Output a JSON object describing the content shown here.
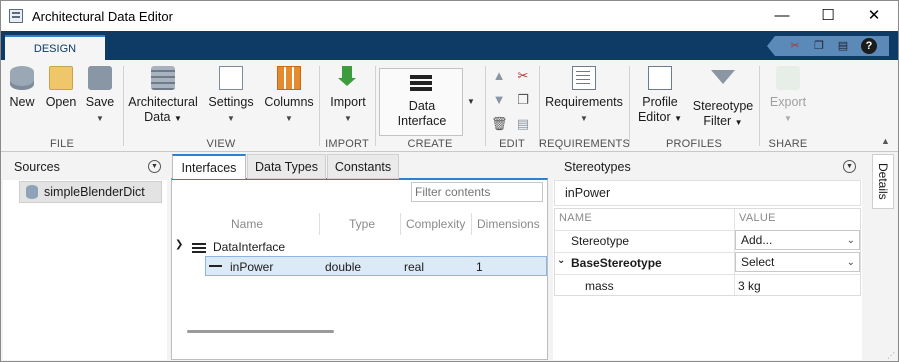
{
  "window": {
    "title": "Architectural Data Editor",
    "minimize": "—",
    "maximize": "☐",
    "close": "✕"
  },
  "ribbon_tab": "DESIGN",
  "quick_access": {
    "help": "?"
  },
  "toolstrip": {
    "file": {
      "label": "FILE",
      "new": "New",
      "open": "Open",
      "save": "Save"
    },
    "view": {
      "label": "VIEW",
      "arch_data_1": "Architectural",
      "arch_data_2": "Data",
      "settings": "Settings",
      "columns": "Columns"
    },
    "import": {
      "label": "IMPORT",
      "import": "Import"
    },
    "create": {
      "label": "CREATE",
      "data_interface_1": "Data",
      "data_interface_2": "Interface"
    },
    "edit": {
      "label": "EDIT"
    },
    "requirements": {
      "label": "REQUIREMENTS",
      "requirements": "Requirements"
    },
    "profiles": {
      "label": "PROFILES",
      "profile_editor_1": "Profile",
      "profile_editor_2": "Editor",
      "stereotype_filter_1": "Stereotype",
      "stereotype_filter_2": "Filter"
    },
    "share": {
      "label": "SHARE",
      "export": "Export"
    }
  },
  "sources": {
    "title": "Sources",
    "items": [
      "simpleBlenderDict"
    ]
  },
  "center": {
    "tabs": [
      "Interfaces",
      "Data Types",
      "Constants"
    ],
    "filter_placeholder": "Filter contents",
    "columns": [
      "Name",
      "Type",
      "Complexity",
      "Dimensions"
    ],
    "interface": "DataInterface",
    "rows": [
      {
        "name": "inPower",
        "type": "double",
        "complexity": "real",
        "dimensions": "1"
      }
    ]
  },
  "stereotypes": {
    "title": "Stereotypes",
    "selected": "inPower",
    "headers": [
      "NAME",
      "VALUE"
    ],
    "rows": [
      {
        "name": "Stereotype",
        "value": "Add..."
      },
      {
        "name": "BaseStereotype",
        "value": "Select"
      },
      {
        "name": "mass",
        "value": "3 kg"
      }
    ]
  },
  "details_label": "Details"
}
